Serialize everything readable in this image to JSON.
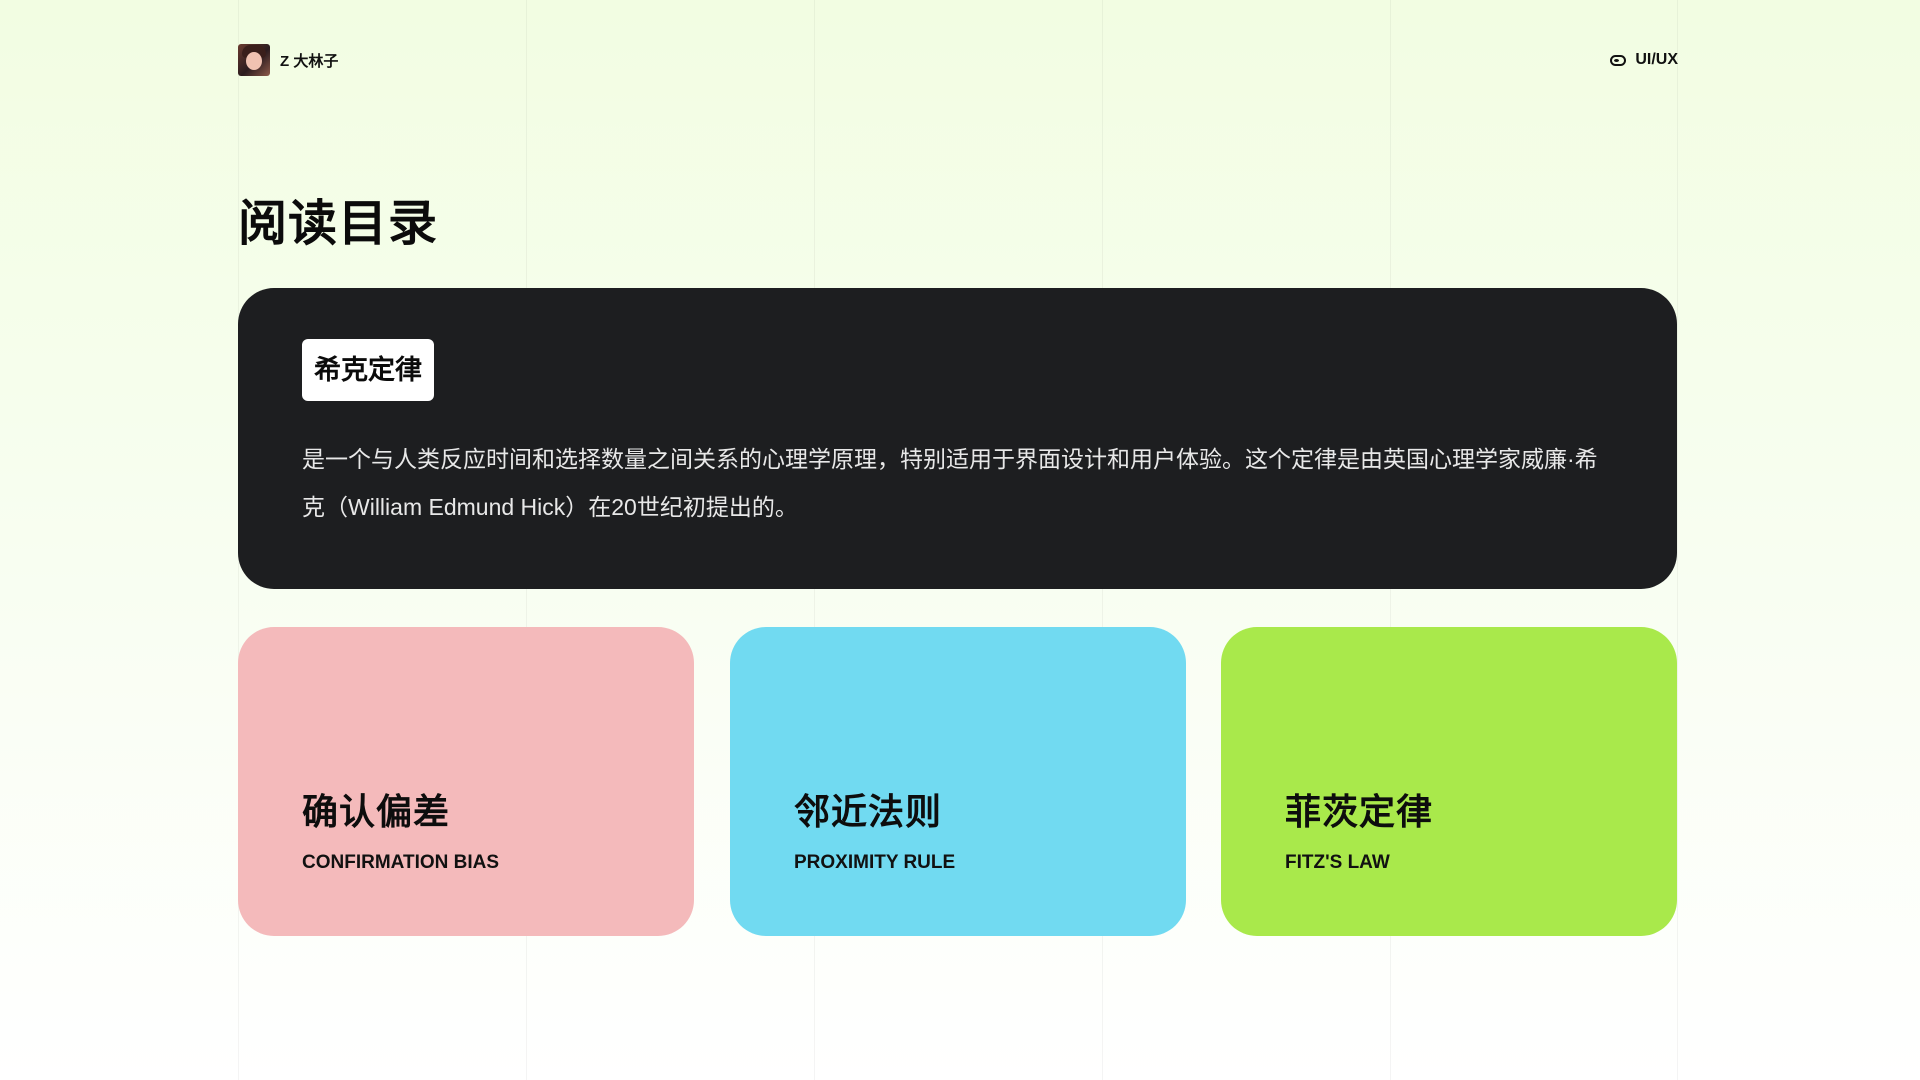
{
  "header": {
    "brand_name": "Z 大林子",
    "avatar_icon": "avatar-portrait",
    "tag_icon": "toggle-icon",
    "tag_label": "UI/UX"
  },
  "page_title": "阅读目录",
  "hero": {
    "pill_label": "希克定律",
    "description": "是一个与人类反应时间和选择数量之间关系的心理学原理，特别适用于界面设计和用户体验。这个定律是由英国心理学家威廉·希克（William Edmund Hick）在20世纪初提出的。",
    "background_color": "#1d1e20"
  },
  "cards": [
    {
      "title": "确认偏差",
      "subtitle": "CONFIRMATION BIAS",
      "color": "#f4babb"
    },
    {
      "title": "邻近法则",
      "subtitle": "PROXIMITY RULE",
      "color": "#71daf1"
    },
    {
      "title": "菲茨定律",
      "subtitle": "FITZ'S LAW",
      "color": "#a9e94b"
    }
  ],
  "colors": {
    "background_top": "#f2fde2",
    "background_bottom": "#ffffff",
    "text": "#111111"
  }
}
